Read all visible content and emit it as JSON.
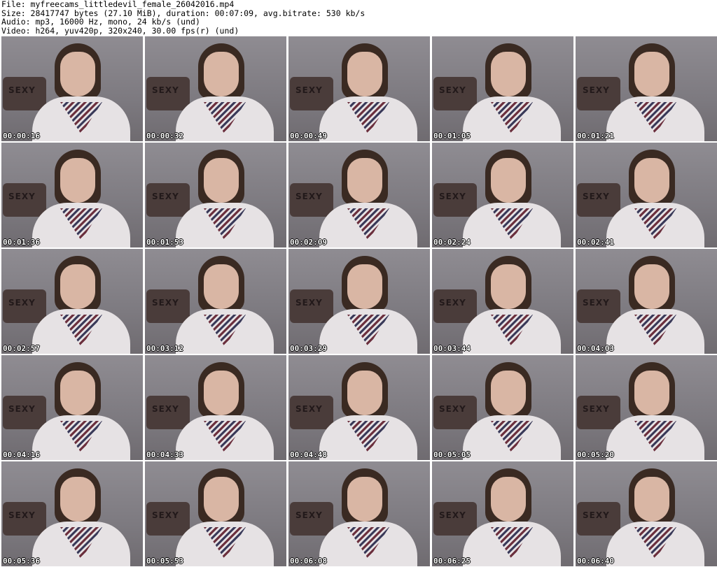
{
  "header": {
    "file_line": "File: myfreecams_littledevil_female_26042016.mp4",
    "size_line": "Size: 28417747 bytes (27.10 MiB), duration: 00:07:09, avg.bitrate: 530 kb/s",
    "audio_line": "Audio: mp3, 16000 Hz, mono, 24 kb/s (und)",
    "video_line": "Video: h264, yuv420p, 320x240, 30.00 fps(r) (und)"
  },
  "thumbnails": [
    {
      "timestamp": "00:00:16"
    },
    {
      "timestamp": "00:00:32"
    },
    {
      "timestamp": "00:00:49"
    },
    {
      "timestamp": "00:01:05"
    },
    {
      "timestamp": "00:01:21"
    },
    {
      "timestamp": "00:01:36"
    },
    {
      "timestamp": "00:01:53"
    },
    {
      "timestamp": "00:02:09"
    },
    {
      "timestamp": "00:02:24"
    },
    {
      "timestamp": "00:02:41"
    },
    {
      "timestamp": "00:02:57"
    },
    {
      "timestamp": "00:03:12"
    },
    {
      "timestamp": "00:03:29"
    },
    {
      "timestamp": "00:03:44"
    },
    {
      "timestamp": "00:04:03"
    },
    {
      "timestamp": "00:04:16"
    },
    {
      "timestamp": "00:04:33"
    },
    {
      "timestamp": "00:04:48"
    },
    {
      "timestamp": "00:05:05"
    },
    {
      "timestamp": "00:05:20"
    },
    {
      "timestamp": "00:05:36"
    },
    {
      "timestamp": "00:05:53"
    },
    {
      "timestamp": "00:06:08"
    },
    {
      "timestamp": "00:06:25"
    },
    {
      "timestamp": "00:06:40"
    }
  ],
  "pillow_text": "SEXY"
}
